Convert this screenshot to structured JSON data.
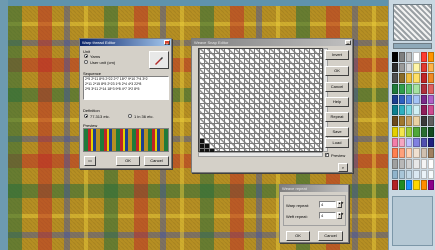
{
  "palette_colors": [
    "#000000",
    "#7f7f7f",
    "#bfbfbf",
    "#ffffff",
    "#ff3b30",
    "#ff9500",
    "#2b2b2b",
    "#9a9a9a",
    "#d9d9d9",
    "#fff6a8",
    "#e2382f",
    "#ffb347",
    "#4d4d4d",
    "#8a6c2a",
    "#f0c040",
    "#ffe066",
    "#c02424",
    "#f08a24",
    "#1f7a3a",
    "#2f9e4d",
    "#5cc36c",
    "#a6e3a1",
    "#b0303c",
    "#e06060",
    "#1d3f8f",
    "#2f60c0",
    "#5b8be0",
    "#a4c3f5",
    "#7a2a8a",
    "#b060c8",
    "#0d7f8f",
    "#2fb0c0",
    "#7ad7e0",
    "#d0f0f5",
    "#8f1d5a",
    "#d04a90",
    "#6b4a1d",
    "#a0782f",
    "#c8a060",
    "#ead2a4",
    "#3a3a3a",
    "#606060",
    "#e4d000",
    "#f2e64d",
    "#9fd03a",
    "#4fa83a",
    "#2a6e30",
    "#124a20",
    "#f27ea9",
    "#f5a5c0",
    "#c0c0ff",
    "#8080e0",
    "#5050b0",
    "#202080",
    "#ff7f50",
    "#ffa07a",
    "#ffd0b0",
    "#f0e0d0",
    "#d0c0b0",
    "#a08060",
    "#9fa0a0",
    "#b8b8b8",
    "#d0d0d0",
    "#e8e8e8",
    "#f4f4f4",
    "#ffffff",
    "#8fb4cc",
    "#a8c6d8",
    "#c2d8e6",
    "#dbe9f2",
    "#eaf3f8",
    "#f6fbfd",
    "#b22222",
    "#228b22",
    "#1e90ff",
    "#ffd700",
    "#ff8c00",
    "#8b008b"
  ],
  "warp_editor": {
    "title": "Warp thread Editor",
    "unit_label": "Unit",
    "unit_options": [
      "Yarns",
      "User unit (cm)"
    ],
    "sequence_label": "Sequence",
    "sequence_lines": [
      "2*5 2*11 8*5 2*22 2*7 18*7 9*10 7*4 3*2",
      "2*11 2*15 8*5 2*23 1*5 2*4 4*3 22*8",
      "2*5 3*11 2*14 18*3 9*8 4*7 3*2 8*5"
    ],
    "definition_label": "Definition",
    "definition_options": [
      "77.313 etc.",
      "1 in 36 etc."
    ],
    "preview_label": "Preview",
    "ok_label": "OK",
    "cancel_label": "Cancel"
  },
  "weave_editor": {
    "title": "Weave  Snap  Editor",
    "buttons": [
      "Invert",
      "OK",
      "Cancel",
      "Help",
      "Repeat",
      "Save",
      "Load"
    ],
    "preview_label": "Preview"
  },
  "weave_repeat": {
    "title": "Weave repeat",
    "warp_label": "Warp repeat:",
    "warp_value": "4",
    "weft_label": "Weft repeat:",
    "weft_value": "4",
    "ok_label": "OK",
    "cancel_label": "Cancel"
  }
}
